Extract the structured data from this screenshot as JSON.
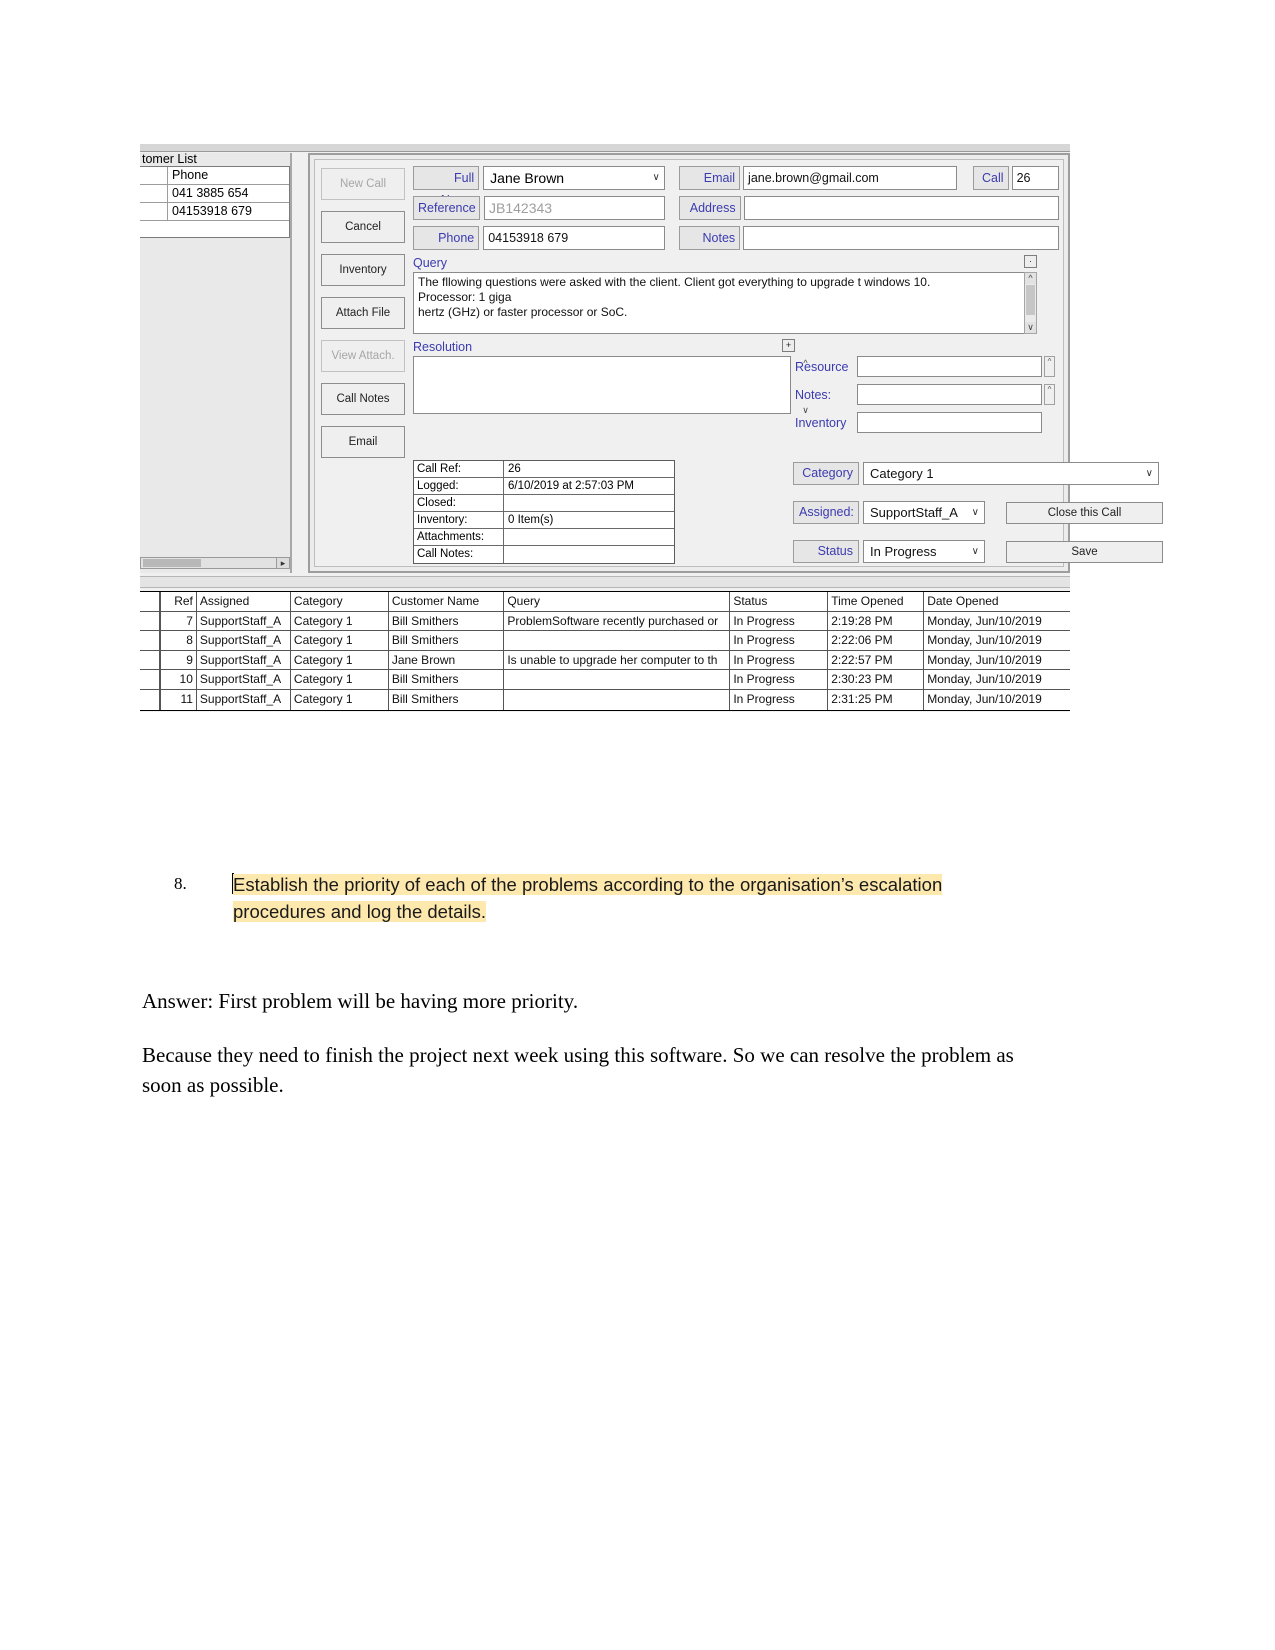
{
  "app": {
    "customer_list": {
      "title": "tomer List",
      "columns": [
        "",
        "Phone"
      ],
      "rows": [
        {
          "ref": "",
          "phone": "041 3885 654"
        },
        {
          "ref": "",
          "phone": "04153918 679"
        }
      ],
      "scroll_arrow": "▸"
    },
    "buttons": [
      {
        "label": "New Call",
        "disabled": true
      },
      {
        "label": "Cancel",
        "disabled": false
      },
      {
        "label": "Inventory",
        "disabled": false
      },
      {
        "label": "Attach File",
        "disabled": false
      },
      {
        "label": "View Attach.",
        "disabled": true
      },
      {
        "label": "Call Notes",
        "disabled": false
      },
      {
        "label": "Email",
        "disabled": false
      }
    ],
    "fields": {
      "full_name_label": "Full Name",
      "full_name_value": "Jane Brown",
      "reference_label": "Reference",
      "reference_placeholder": "JB142343",
      "phone_label": "Phone",
      "phone_value": "04153918 679",
      "email_label": "Email",
      "email_value": "jane.brown@gmail.com",
      "address_label": "Address",
      "address_value": "",
      "notes_label": "Notes",
      "notes_value": "",
      "call_label": "Call",
      "call_value": "26"
    },
    "query": {
      "section_label": "Query",
      "text_line1": "The fllowing questions were asked with the client. Client got everything to upgrade t  windows 10.",
      "text_line2": "Processor: 1 giga",
      "text_line3": "hertz (GHz) or faster processor or SoC.",
      "expand_button": "·"
    },
    "resolution": {
      "section_label": "Resolution",
      "value": "",
      "add_button": "+"
    },
    "details": {
      "rows": [
        {
          "key": "Call Ref:",
          "value": "26"
        },
        {
          "key": "Logged:",
          "value": "6/10/2019  at  2:57:03 PM"
        },
        {
          "key": "Closed:",
          "value": ""
        },
        {
          "key": "Inventory:",
          "value": "0 Item(s)"
        },
        {
          "key": "Attachments:",
          "value": ""
        },
        {
          "key": "Call Notes:",
          "value": ""
        }
      ]
    },
    "right_panel": {
      "resource_label": "Resource",
      "resource_value": "",
      "notes_label": "Notes:",
      "notes_value": "",
      "inventory_label": "Inventory",
      "inventory_value": "",
      "category_label": "Category",
      "category_value": "Category 1",
      "assigned_label": "Assigned:",
      "assigned_value": "SupportStaff_A",
      "status_label": "Status",
      "status_value": "In Progress",
      "close_call_button": "Close this Call",
      "save_button": "Save",
      "caret_icon": "∨"
    },
    "results_grid": {
      "columns": [
        "Ref",
        "Assigned",
        "Category",
        "Customer Name",
        "Query",
        "Status",
        "Time Opened",
        "Date Opened"
      ],
      "rows": [
        {
          "ref": "7",
          "assigned": "SupportStaff_A",
          "category": "Category 1",
          "customer": "Bill Smithers",
          "query": "ProblemSoftware recently purchased or",
          "status": "In Progress",
          "time": "2:19:28 PM",
          "date": "Monday, Jun/10/2019"
        },
        {
          "ref": "8",
          "assigned": "SupportStaff_A",
          "category": "Category 1",
          "customer": "Bill Smithers",
          "query": "",
          "status": "In Progress",
          "time": "2:22:06 PM",
          "date": "Monday, Jun/10/2019"
        },
        {
          "ref": "9",
          "assigned": "SupportStaff_A",
          "category": "Category 1",
          "customer": "Jane Brown",
          "query": "Is unable to upgrade her computer to th",
          "status": "In Progress",
          "time": "2:22:57 PM",
          "date": "Monday, Jun/10/2019"
        },
        {
          "ref": "10",
          "assigned": "SupportStaff_A",
          "category": "Category 1",
          "customer": "Bill Smithers",
          "query": "",
          "status": "In Progress",
          "time": "2:30:23 PM",
          "date": "Monday, Jun/10/2019"
        },
        {
          "ref": "11",
          "assigned": "SupportStaff_A",
          "category": "Category 1",
          "customer": "Bill Smithers",
          "query": "",
          "status": "In Progress",
          "time": "2:31:25 PM",
          "date": "Monday, Jun/10/2019"
        }
      ]
    }
  },
  "document": {
    "question_number": "8.",
    "question_line1": "Establish the priority of each of the problems according to the organisation’s escalation",
    "question_line2": "procedures and log the details.",
    "answer_paragraph_1": "Answer: First problem will be having more priority.",
    "answer_paragraph_2": "Because they need to finish the project next week using this software. So we can resolve the problem as soon as possible."
  },
  "colors": {
    "label_blue": "#3b3bb0",
    "highlight_yellow": "#fde8ad",
    "window_gray": "#f0f0f0"
  }
}
